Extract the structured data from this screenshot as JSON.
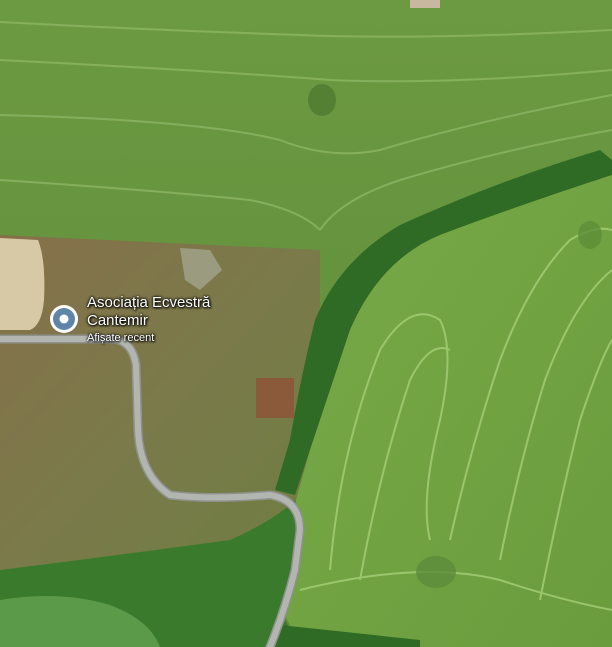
{
  "map": {
    "view": "satellite",
    "place": {
      "name_line1": "Asociația Ecvestră",
      "name_line2": "Cantemir",
      "subtitle": "Afișate recent",
      "icon": "map-pin-icon"
    },
    "colors": {
      "field_top": "#6a9a40",
      "field_right": "#72a544",
      "brush": "#7e7548",
      "forest": "#2f6b25",
      "road": "#a9aca6",
      "pin": "#5f86a8"
    }
  }
}
